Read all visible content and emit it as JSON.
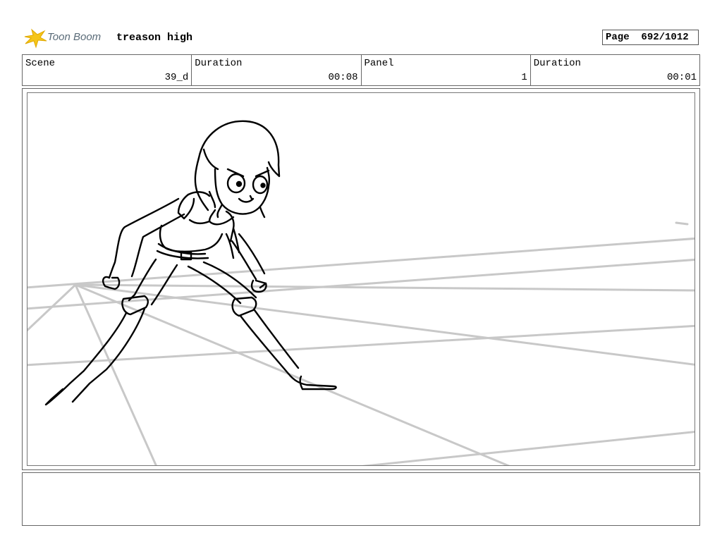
{
  "header": {
    "logo_text": "Toon Boom",
    "project_title": "treason high",
    "page_label": "Page",
    "page_value": "692/1012"
  },
  "info": {
    "scene_label": "Scene",
    "scene_value": "39_d",
    "scene_duration_label": "Duration",
    "scene_duration_value": "00:08",
    "panel_label": "Panel",
    "panel_value": "1",
    "panel_duration_label": "Duration",
    "panel_duration_value": "00:01"
  },
  "notes": {
    "text": ""
  },
  "colors": {
    "guide_lines": "#c8c8c8",
    "ink": "#000000",
    "logo_yellow": "#f5c518",
    "logo_text": "#5a6b78"
  }
}
